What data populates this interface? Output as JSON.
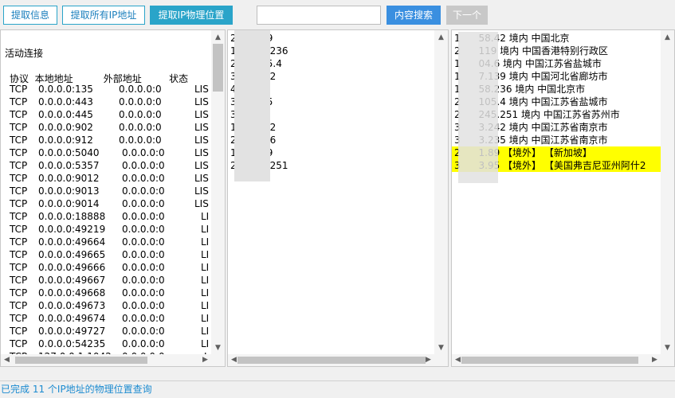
{
  "toolbar": {
    "extract_info_label": "提取信息",
    "extract_all_ips_label": "提取所有IP地址",
    "extract_location_label": "提取IP物理位置",
    "search_value": "",
    "search_button_label": "内容搜索",
    "next_button_label": "下一个"
  },
  "connections": {
    "title": "活动连接",
    "header": "协议  本地地址          外部地址         状态",
    "rows": [
      {
        "proto": "TCP",
        "local": "0.0.0.0:135",
        "remote": "0.0.0.0:0",
        "state": "LIS"
      },
      {
        "proto": "TCP",
        "local": "0.0.0.0:443",
        "remote": "0.0.0.0:0",
        "state": "LIS"
      },
      {
        "proto": "TCP",
        "local": "0.0.0.0:445",
        "remote": "0.0.0.0:0",
        "state": "LIS"
      },
      {
        "proto": "TCP",
        "local": "0.0.0.0:902",
        "remote": "0.0.0.0:0",
        "state": "LIS"
      },
      {
        "proto": "TCP",
        "local": "0.0.0.0:912",
        "remote": "0.0.0.0:0",
        "state": "LIS"
      },
      {
        "proto": "TCP",
        "local": "0.0.0.0:5040",
        "remote": "0.0.0.0:0",
        "state": "LIS"
      },
      {
        "proto": "TCP",
        "local": "0.0.0.0:5357",
        "remote": "0.0.0.0:0",
        "state": "LIS"
      },
      {
        "proto": "TCP",
        "local": "0.0.0.0:9012",
        "remote": "0.0.0.0:0",
        "state": "LIS"
      },
      {
        "proto": "TCP",
        "local": "0.0.0.0:9013",
        "remote": "0.0.0.0:0",
        "state": "LIS"
      },
      {
        "proto": "TCP",
        "local": "0.0.0.0:9014",
        "remote": "0.0.0.0:0",
        "state": "LIS"
      },
      {
        "proto": "TCP",
        "local": "0.0.0.0:18888",
        "remote": "0.0.0.0:0",
        "state": "LI"
      },
      {
        "proto": "TCP",
        "local": "0.0.0.0:49219",
        "remote": "0.0.0.0:0",
        "state": "LI"
      },
      {
        "proto": "TCP",
        "local": "0.0.0.0:49664",
        "remote": "0.0.0.0:0",
        "state": "LI"
      },
      {
        "proto": "TCP",
        "local": "0.0.0.0:49665",
        "remote": "0.0.0.0:0",
        "state": "LI"
      },
      {
        "proto": "TCP",
        "local": "0.0.0.0:49666",
        "remote": "0.0.0.0:0",
        "state": "LI"
      },
      {
        "proto": "TCP",
        "local": "0.0.0.0:49667",
        "remote": "0.0.0.0:0",
        "state": "LI"
      },
      {
        "proto": "TCP",
        "local": "0.0.0.0:49668",
        "remote": "0.0.0.0:0",
        "state": "LI"
      },
      {
        "proto": "TCP",
        "local": "0.0.0.0:49673",
        "remote": "0.0.0.0:0",
        "state": "LI"
      },
      {
        "proto": "TCP",
        "local": "0.0.0.0:49674",
        "remote": "0.0.0.0:0",
        "state": "LI"
      },
      {
        "proto": "TCP",
        "local": "0.0.0.0:49727",
        "remote": "0.0.0.0:0",
        "state": "LI"
      },
      {
        "proto": "TCP",
        "local": "0.0.0.0:54235",
        "remote": "0.0.0.0:0",
        "state": "LI"
      },
      {
        "proto": "TCP",
        "local": "127.0.0.1:1042",
        "remote": "0.0.0.0:0",
        "state": "L"
      }
    ]
  },
  "ip_list": [
    "2      119",
    "1      58.236",
    "2      105.4",
    "3      .242",
    "4      89",
    "3      235",
    "3      95",
    "1      8.42",
    "2      04.6",
    "1      139",
    "2      45.251"
  ],
  "locations": [
    {
      "text": "1      58.42 境内 中国北京",
      "highlight": false
    },
    {
      "text": "2      119 境内 中国香港特别行政区",
      "highlight": false
    },
    {
      "text": "1      04.6 境内 中国江苏省盐城市",
      "highlight": false
    },
    {
      "text": "1      7.139 境内 中国河北省廊坊市",
      "highlight": false
    },
    {
      "text": "1      58.236 境内 中国北京市",
      "highlight": false
    },
    {
      "text": "2      105.4 境内 中国江苏省盐城市",
      "highlight": false
    },
    {
      "text": "2      245.251 境内 中国江苏省苏州市",
      "highlight": false
    },
    {
      "text": "3      3.242 境内 中国江苏省南京市",
      "highlight": false
    },
    {
      "text": "3      3.235 境内 中国江苏省南京市",
      "highlight": false
    },
    {
      "text": "2      1.89 【境外】 【新加坡】",
      "highlight": true
    },
    {
      "text": "3      3.95 【境外】 【美国弗吉尼亚州阿什2",
      "highlight": true
    }
  ],
  "status": "已完成 11 个IP地址的物理位置查询",
  "icons": {
    "scroll_up": "▲",
    "scroll_down": "▼",
    "scroll_left": "◀",
    "scroll_right": "▶"
  },
  "colors": {
    "accent": "#2aa4c9",
    "search": "#3a8fe0",
    "highlight": "#ffff00",
    "status_text": "#1c8bd0"
  }
}
